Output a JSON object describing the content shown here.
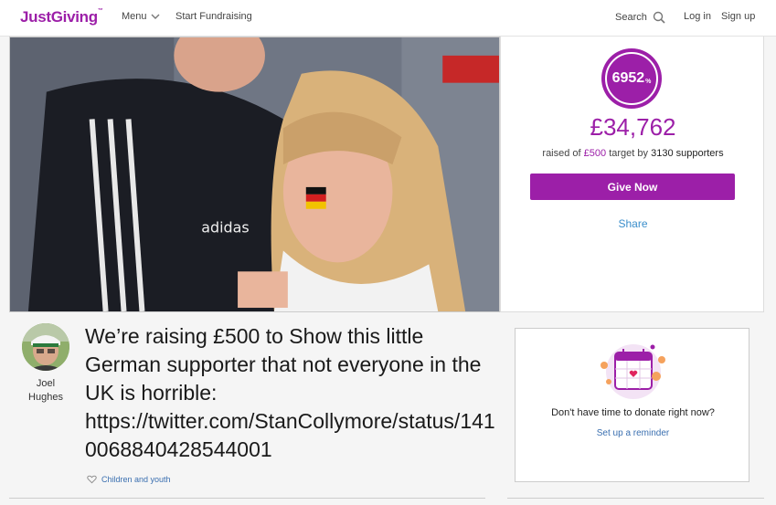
{
  "header": {
    "logo": "JustGiving",
    "logo_tm": "™",
    "menu_label": "Menu",
    "start_label": "Start Fundraising",
    "search_label": "Search",
    "login_label": "Log in",
    "signup_label": "Sign up"
  },
  "stats": {
    "percent": "6952",
    "percent_sign": "%",
    "raised": "£34,762",
    "raised_of_prefix": "raised of",
    "target": "£500",
    "target_by": "target by",
    "supporters": "3130 supporters",
    "progress_percent": 6952
  },
  "actions": {
    "give_now": "Give Now",
    "share": "Share"
  },
  "fundraiser": {
    "name_first": "Joel",
    "name_last": "Hughes"
  },
  "page": {
    "title": "We’re raising £500 to Show this little German supporter that not everyone in the UK is horrible: https://twitter.com/StanCollymore/status/1410068840428544001",
    "category": "Children and youth"
  },
  "reminder": {
    "text": "Don't have time to donate right now?",
    "link": "Set up a reminder"
  },
  "colors": {
    "brand": "#9c1fa8",
    "link": "#3a8ecb"
  }
}
